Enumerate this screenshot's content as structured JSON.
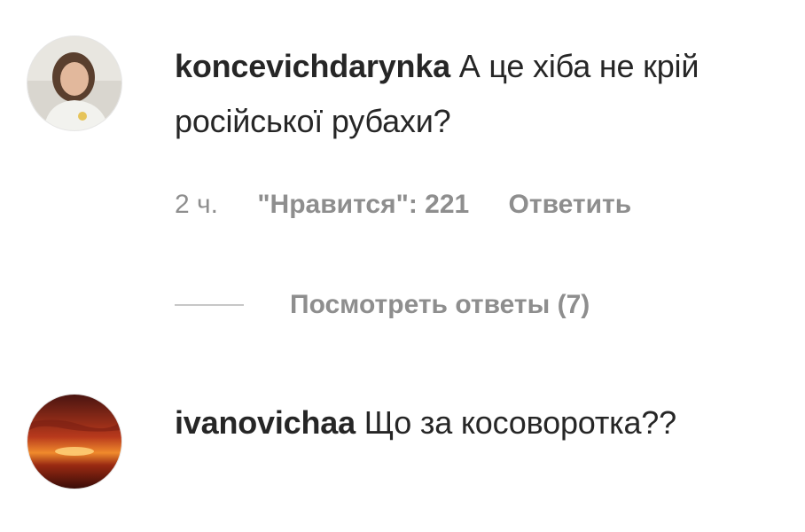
{
  "comments": [
    {
      "username": "koncevichdarynka",
      "text": "А це хіба не крій російської рубахи?",
      "time": "2 ч.",
      "likes": "\"Нравится\": 221",
      "reply_label": "Ответить",
      "view_replies": "Посмотреть ответы (7)",
      "avatar_icon": "user-avatar"
    },
    {
      "username": "ivanovichaa",
      "text": "Що за косоворотка??",
      "avatar_icon": "sunset-avatar"
    }
  ]
}
